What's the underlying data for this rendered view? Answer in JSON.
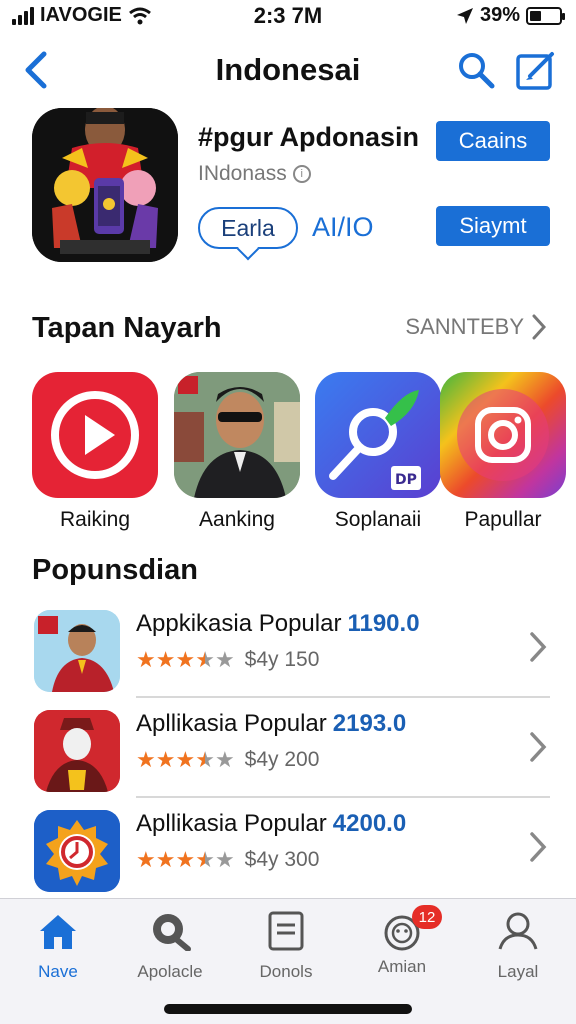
{
  "status": {
    "carrier": "IAVOGIE",
    "time": "2:3 7M",
    "battery": "39%",
    "battery_level": 0.39
  },
  "nav": {
    "title": "Indonesai"
  },
  "app": {
    "name": "#pgur Apdonasin",
    "developer": "INdonass",
    "get_label": "Caains",
    "bubble_label": "Earla",
    "aio_label": "AI/IO",
    "save_label": "Siaymt"
  },
  "top_section": {
    "title": "Tapan Nayarh",
    "see_all": "SANNTEBY",
    "apps": [
      {
        "label": "Raiking",
        "icon": "play-icon"
      },
      {
        "label": "Aanking",
        "icon": "photo-man-icon"
      },
      {
        "label": "Soplanaii",
        "icon": "leaf-pin-icon",
        "tag": "DP"
      },
      {
        "label": "Papullar",
        "icon": "instagram-icon"
      }
    ]
  },
  "popular": {
    "title": "Popunsdian",
    "items": [
      {
        "name": "Appkikasia Popular",
        "score": "1190.0",
        "rating": 3.5,
        "price": "$4y 150"
      },
      {
        "name": "Apllikasia Popular",
        "score": "2193.0",
        "rating": 3.5,
        "price": "$4y 200"
      },
      {
        "name": "Apllikasia Popular",
        "score": "4200.0",
        "rating": 3.5,
        "price": "$4y 300"
      }
    ]
  },
  "tabs": [
    {
      "label": "Nave",
      "icon": "house-icon",
      "active": true
    },
    {
      "label": "Apolacle",
      "icon": "magnifier-icon",
      "active": false
    },
    {
      "label": "Donols",
      "icon": "document-icon",
      "active": false
    },
    {
      "label": "Amian",
      "icon": "face-icon",
      "active": false,
      "badge": "12"
    },
    {
      "label": "Layal",
      "icon": "person-icon",
      "active": false
    }
  ],
  "colors": {
    "accent": "#1a6fd6",
    "badge": "#e52d27",
    "star": "#f0731f"
  }
}
